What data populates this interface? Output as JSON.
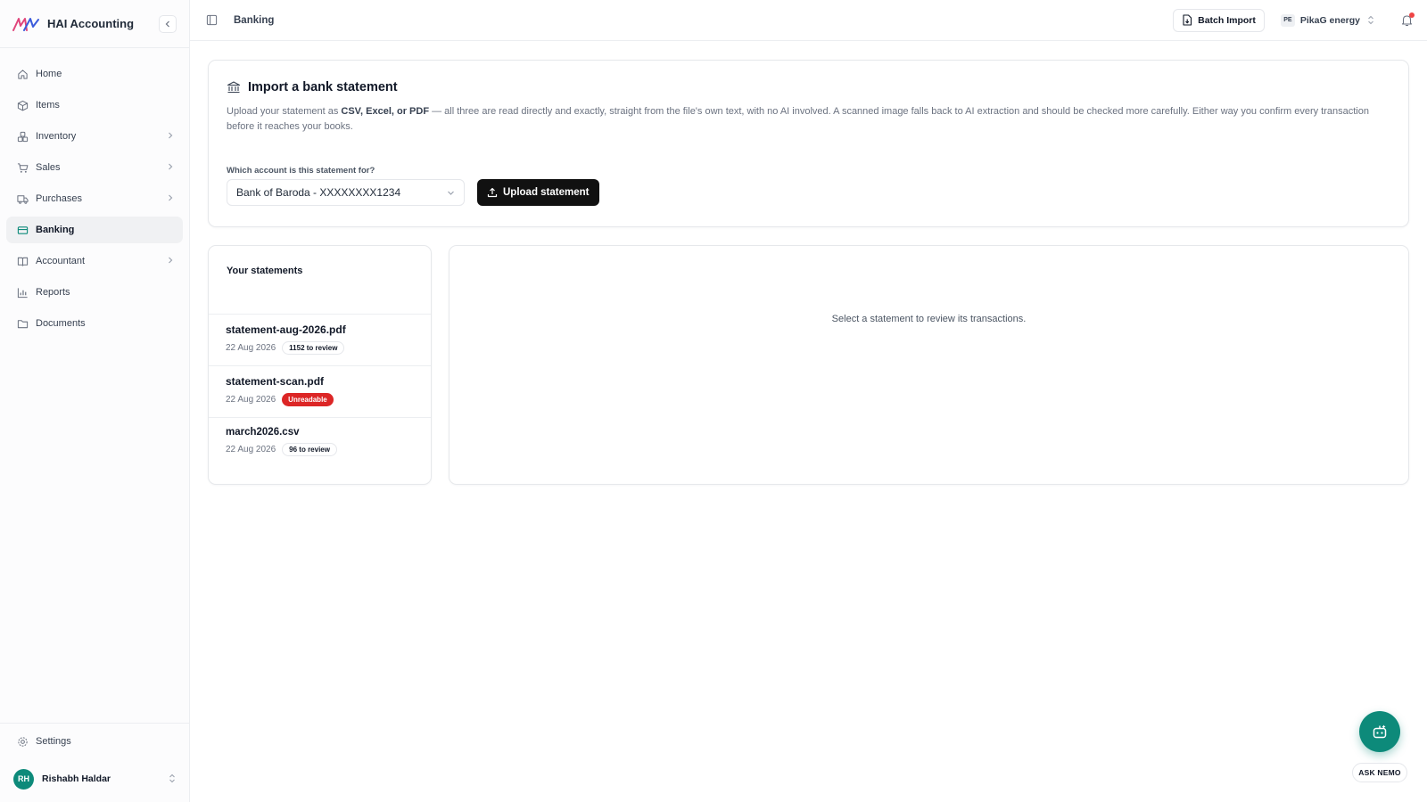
{
  "app": {
    "name": "HAI Accounting"
  },
  "colors": {
    "accent": "#0d8a7a",
    "primary_button": "#111111",
    "danger": "#dc2626"
  },
  "sidebar": {
    "items": [
      {
        "label": "Home",
        "icon": "home-icon",
        "has_submenu": false,
        "active": false
      },
      {
        "label": "Items",
        "icon": "box-icon",
        "has_submenu": false,
        "active": false
      },
      {
        "label": "Inventory",
        "icon": "boxes-icon",
        "has_submenu": true,
        "active": false
      },
      {
        "label": "Sales",
        "icon": "cart-icon",
        "has_submenu": true,
        "active": false
      },
      {
        "label": "Purchases",
        "icon": "truck-icon",
        "has_submenu": true,
        "active": false
      },
      {
        "label": "Banking",
        "icon": "card-icon",
        "has_submenu": false,
        "active": true
      },
      {
        "label": "Accountant",
        "icon": "book-icon",
        "has_submenu": true,
        "active": false
      },
      {
        "label": "Reports",
        "icon": "bar-chart-icon",
        "has_submenu": false,
        "active": false
      },
      {
        "label": "Documents",
        "icon": "folder-icon",
        "has_submenu": false,
        "active": false
      }
    ],
    "settings_label": "Settings",
    "user": {
      "initials": "RH",
      "name": "Rishabh Haldar"
    }
  },
  "header": {
    "breadcrumb": "Banking",
    "batch_import_label": "Batch Import",
    "org": {
      "badge": "PE",
      "name": "PikaG energy"
    },
    "has_notification": true
  },
  "import_card": {
    "title": "Import a bank statement",
    "desc_before": "Upload your statement as ",
    "desc_formats": "CSV, Excel, or PDF",
    "desc_after": " — all three are read directly and exactly, straight from the file's own text, with no AI involved. A scanned image falls back to AI extraction and should be checked more carefully. Either way you confirm every transaction before it reaches your books.",
    "account_label": "Which account is this statement for?",
    "account_selected": "Bank of Baroda - XXXXXXXX1234",
    "upload_label": "Upload statement"
  },
  "statements": {
    "title": "Your statements",
    "items": [
      {
        "name": "statement-aug-2026.pdf",
        "date": "22 Aug 2026",
        "badge": "1152 to review",
        "status": "review"
      },
      {
        "name": "statement-scan.pdf",
        "date": "22 Aug 2026",
        "badge": "Unreadable",
        "status": "error"
      },
      {
        "name": "march2026.csv",
        "date": "22 Aug 2026",
        "badge": "96 to review",
        "status": "review"
      }
    ]
  },
  "review_panel": {
    "empty_text": "Select a statement to review its transactions."
  },
  "assistant": {
    "label": "ASK NEMO"
  }
}
